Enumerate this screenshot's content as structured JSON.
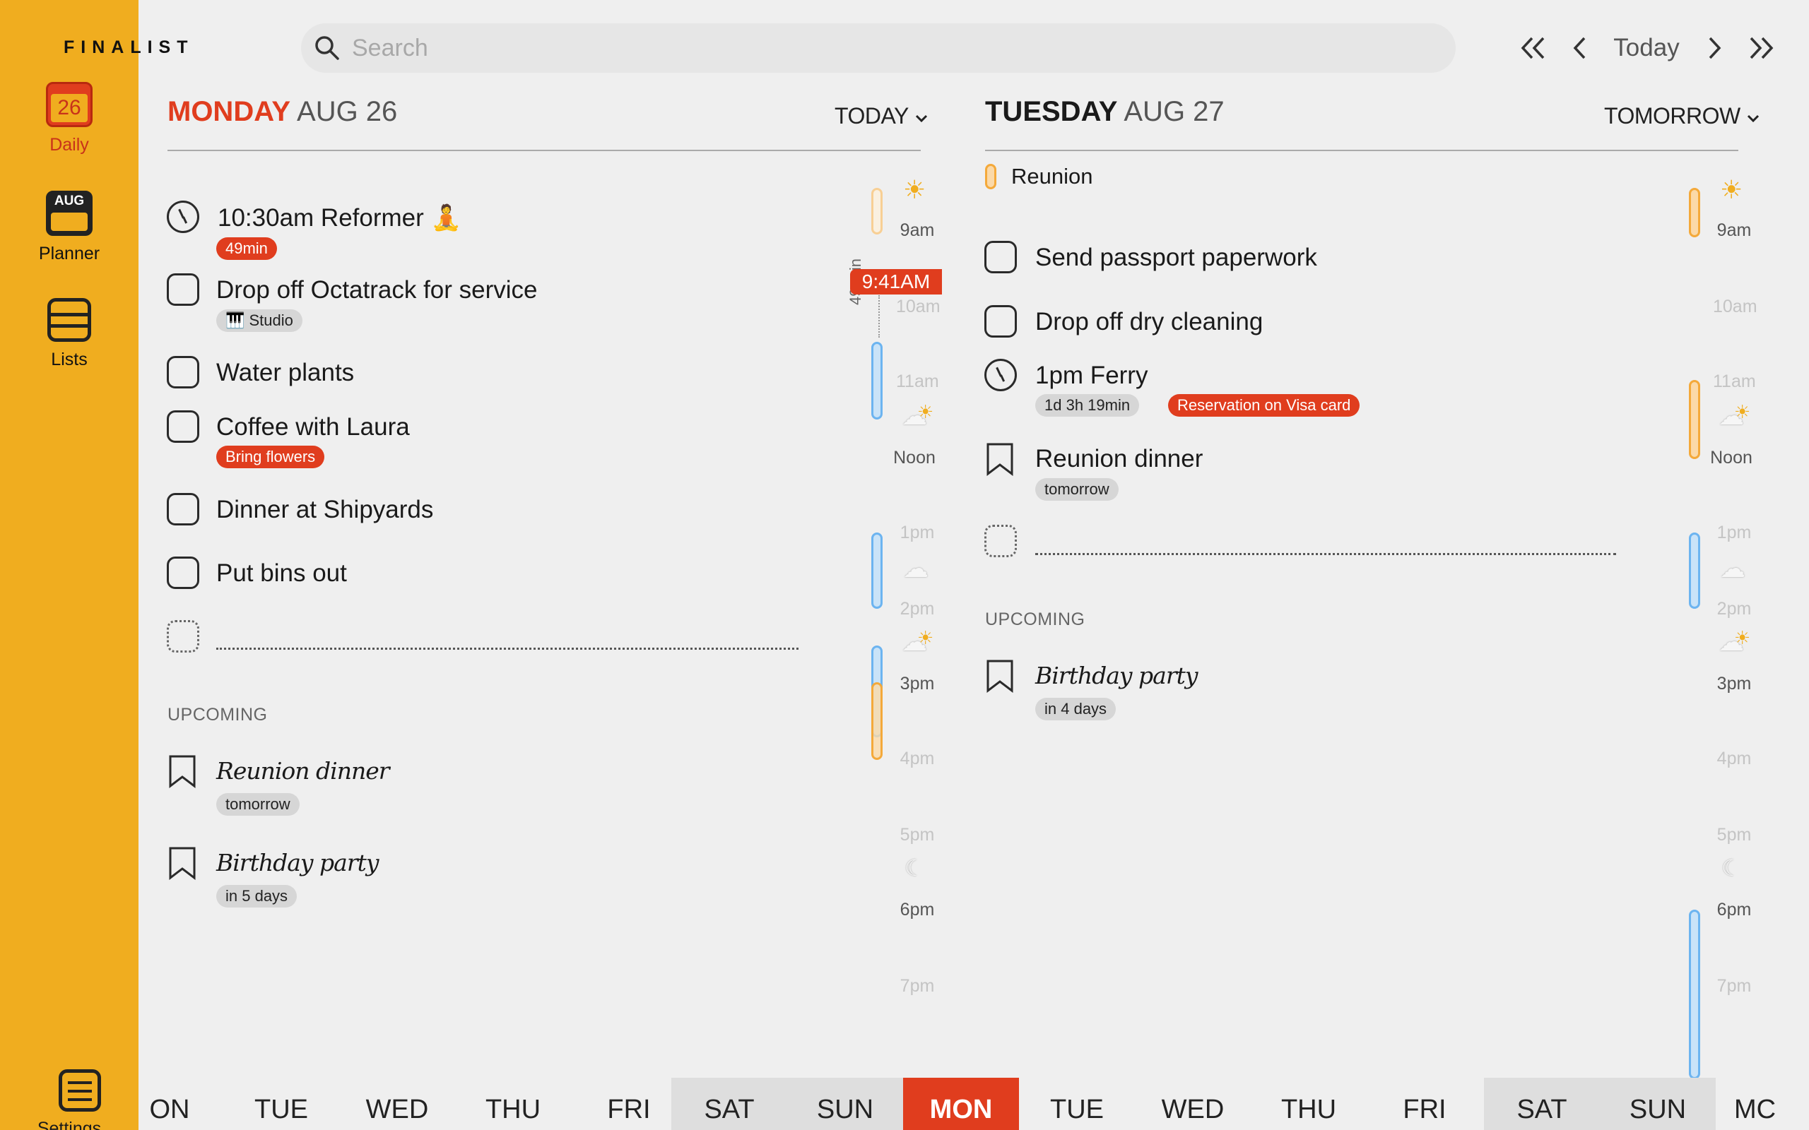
{
  "sidebar": {
    "logo": "FINALIST",
    "daily": {
      "icon_text": "26",
      "label": "Daily"
    },
    "planner": {
      "icon_text": "AUG",
      "label": "Planner"
    },
    "lists": {
      "label": "Lists"
    },
    "settings": {
      "label": "Settings"
    }
  },
  "topbar": {
    "search_placeholder": "Search",
    "today_label": "Today"
  },
  "monday": {
    "dow": "MONDAY",
    "date": "AUG 26",
    "selector": "TODAY",
    "tasks": [
      {
        "title": "10:30am Reformer",
        "emoji": "🧘",
        "tag": "49min",
        "type": "clock"
      },
      {
        "title": "Drop off Octatrack for service",
        "tag": "🎹 Studio",
        "type": "check"
      },
      {
        "title": "Water plants",
        "type": "check"
      },
      {
        "title": "Coffee with Laura",
        "tag": "Bring flowers",
        "type": "check"
      },
      {
        "title": "Dinner at Shipyards",
        "type": "check"
      },
      {
        "title": "Put bins out",
        "type": "check"
      }
    ],
    "upcoming_label": "UPCOMING",
    "upcoming": [
      {
        "title": "Reunion dinner",
        "tag": "tomorrow"
      },
      {
        "title": "Birthday party",
        "tag": "in 5 days"
      }
    ],
    "timeline": {
      "now": "9:41AM",
      "duration": "49 min",
      "hours": [
        "9am",
        "10am",
        "11am",
        "Noon",
        "1pm",
        "2pm",
        "3pm",
        "4pm",
        "5pm",
        "6pm",
        "7pm"
      ]
    }
  },
  "tuesday": {
    "dow": "TUESDAY",
    "date": "AUG 27",
    "selector": "TOMORROW",
    "allday": "Reunion",
    "tasks": [
      {
        "title": "Send passport paperwork",
        "type": "check"
      },
      {
        "title": "Drop off dry cleaning",
        "type": "check"
      },
      {
        "title": "1pm Ferry",
        "tag": "1d 3h 19min",
        "tag2": "Reservation on Visa card",
        "type": "clock"
      },
      {
        "title": "Reunion dinner",
        "tag": "tomorrow",
        "type": "bookmark"
      }
    ],
    "upcoming_label": "UPCOMING",
    "upcoming": [
      {
        "title": "Birthday party",
        "tag": "in 4 days"
      }
    ],
    "timeline": {
      "hours": [
        "9am",
        "10am",
        "11am",
        "Noon",
        "1pm",
        "2pm",
        "3pm",
        "4pm",
        "5pm",
        "6pm",
        "7pm"
      ]
    }
  },
  "weekstrip": [
    "ON",
    "TUE",
    "WED",
    "THU",
    "FRI",
    "SAT",
    "SUN",
    "MON",
    "TUE",
    "WED",
    "THU",
    "FRI",
    "SAT",
    "SUN",
    "MC"
  ],
  "colors": {
    "accent": "#e03d1e",
    "sidebar": "#f0ad1f",
    "background": "#efefef"
  }
}
